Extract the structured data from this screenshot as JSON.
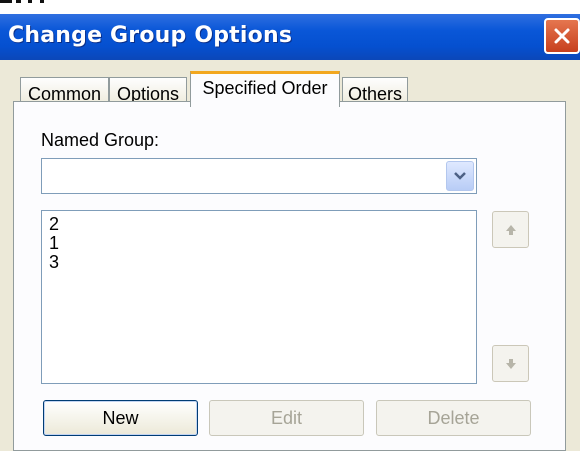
{
  "window": {
    "title": "Change Group Options"
  },
  "tabs": [
    {
      "label": "Common"
    },
    {
      "label": "Options"
    },
    {
      "label": "Specified Order",
      "active": true
    },
    {
      "label": "Others"
    }
  ],
  "named_group": {
    "label": "Named Group:",
    "value": ""
  },
  "order_list": {
    "items": [
      "2",
      "1",
      "3"
    ]
  },
  "buttons": {
    "new": "New",
    "edit": "Edit",
    "delete": "Delete"
  },
  "colors": {
    "titlebar": "#0a57d8",
    "active_tab_accent": "#f2a71f",
    "face": "#ece9d8"
  },
  "icons": {
    "close": "close-icon",
    "combo": "chevron-down-icon",
    "up": "arrow-up-icon",
    "down": "arrow-down-icon"
  }
}
